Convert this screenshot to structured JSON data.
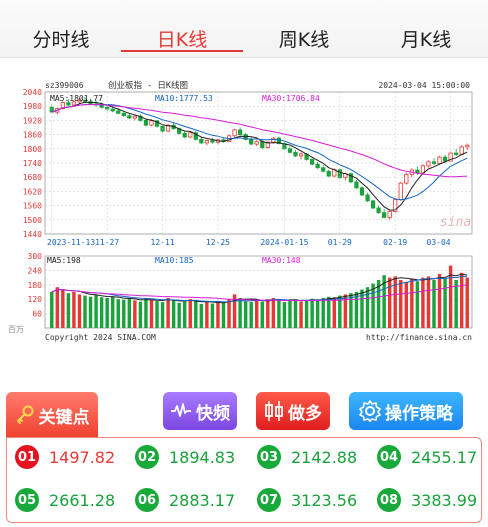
{
  "tabs": [
    {
      "label": "分时线",
      "active": false
    },
    {
      "label": "日K线",
      "active": true
    },
    {
      "label": "周K线",
      "active": false
    },
    {
      "label": "月K线",
      "active": false
    }
  ],
  "chart_header": {
    "symbol": "sz399006",
    "name": "创业板指 - 日K线图",
    "datetime": "2024-03-04 15:00:00",
    "ma5_label": "MA5:1801.77",
    "ma10_label": "MA10:1777.53",
    "ma30_label": "MA30:1706.84"
  },
  "volume_header": {
    "ma5_label": "MA5:198",
    "ma10_label": "MA10:185",
    "ma30_label": "MA30:148",
    "unit": "百万"
  },
  "footer": {
    "copyright": "Copyright 2024 SINA.COM",
    "url": "http://finance.sina.cn",
    "watermark": "sina"
  },
  "colors": {
    "up": "#e53935",
    "down": "#1aa23c",
    "ma5": "#222222",
    "ma10": "#1565c0",
    "ma30": "#d81bd8"
  },
  "chart_data": {
    "type": "candlestick",
    "title": "创业板指 - 日K线图",
    "price_axis": {
      "ylim": [
        1440,
        2040
      ],
      "ticks": [
        2040,
        1980,
        1920,
        1860,
        1800,
        1740,
        1680,
        1620,
        1560,
        1500,
        1440
      ]
    },
    "x_ticks": [
      "2023-11-13",
      "11-27",
      "12-11",
      "12-25",
      "2024-01-15",
      "01-29",
      "02-19",
      "03-04"
    ],
    "volume_axis": {
      "ylim": [
        0,
        300
      ],
      "ticks": [
        300,
        240,
        180,
        120,
        60
      ]
    },
    "candles": [
      {
        "o": 1975,
        "h": 1990,
        "l": 1950,
        "c": 1955
      },
      {
        "o": 1955,
        "h": 1975,
        "l": 1945,
        "c": 1970
      },
      {
        "o": 1970,
        "h": 2000,
        "l": 1965,
        "c": 1995
      },
      {
        "o": 1995,
        "h": 2010,
        "l": 1980,
        "c": 1985
      },
      {
        "o": 1985,
        "h": 2005,
        "l": 1975,
        "c": 1998
      },
      {
        "o": 1998,
        "h": 2015,
        "l": 1990,
        "c": 2005
      },
      {
        "o": 2005,
        "h": 2020,
        "l": 1995,
        "c": 2000
      },
      {
        "o": 2000,
        "h": 2012,
        "l": 1985,
        "c": 1990
      },
      {
        "o": 1990,
        "h": 2005,
        "l": 1978,
        "c": 1985
      },
      {
        "o": 1985,
        "h": 1995,
        "l": 1970,
        "c": 1975
      },
      {
        "o": 1975,
        "h": 1988,
        "l": 1960,
        "c": 1968
      },
      {
        "o": 1968,
        "h": 1980,
        "l": 1955,
        "c": 1960
      },
      {
        "o": 1960,
        "h": 1972,
        "l": 1945,
        "c": 1950
      },
      {
        "o": 1950,
        "h": 1960,
        "l": 1935,
        "c": 1940
      },
      {
        "o": 1940,
        "h": 1950,
        "l": 1925,
        "c": 1930
      },
      {
        "o": 1930,
        "h": 1945,
        "l": 1920,
        "c": 1938
      },
      {
        "o": 1938,
        "h": 1946,
        "l": 1915,
        "c": 1920
      },
      {
        "o": 1920,
        "h": 1928,
        "l": 1895,
        "c": 1900
      },
      {
        "o": 1900,
        "h": 1925,
        "l": 1895,
        "c": 1918
      },
      {
        "o": 1918,
        "h": 1922,
        "l": 1890,
        "c": 1895
      },
      {
        "o": 1895,
        "h": 1900,
        "l": 1870,
        "c": 1875
      },
      {
        "o": 1875,
        "h": 1905,
        "l": 1870,
        "c": 1900
      },
      {
        "o": 1900,
        "h": 1910,
        "l": 1880,
        "c": 1885
      },
      {
        "o": 1885,
        "h": 1890,
        "l": 1860,
        "c": 1865
      },
      {
        "o": 1865,
        "h": 1878,
        "l": 1845,
        "c": 1850
      },
      {
        "o": 1850,
        "h": 1872,
        "l": 1845,
        "c": 1868
      },
      {
        "o": 1868,
        "h": 1875,
        "l": 1835,
        "c": 1840
      },
      {
        "o": 1840,
        "h": 1852,
        "l": 1820,
        "c": 1825
      },
      {
        "o": 1825,
        "h": 1840,
        "l": 1815,
        "c": 1835
      },
      {
        "o": 1835,
        "h": 1845,
        "l": 1822,
        "c": 1828
      },
      {
        "o": 1828,
        "h": 1842,
        "l": 1818,
        "c": 1838
      },
      {
        "o": 1838,
        "h": 1848,
        "l": 1825,
        "c": 1830
      },
      {
        "o": 1830,
        "h": 1860,
        "l": 1828,
        "c": 1855
      },
      {
        "o": 1855,
        "h": 1885,
        "l": 1850,
        "c": 1880
      },
      {
        "o": 1880,
        "h": 1890,
        "l": 1855,
        "c": 1860
      },
      {
        "o": 1860,
        "h": 1866,
        "l": 1835,
        "c": 1840
      },
      {
        "o": 1840,
        "h": 1848,
        "l": 1815,
        "c": 1820
      },
      {
        "o": 1820,
        "h": 1836,
        "l": 1812,
        "c": 1830
      },
      {
        "o": 1830,
        "h": 1838,
        "l": 1800,
        "c": 1805
      },
      {
        "o": 1805,
        "h": 1832,
        "l": 1800,
        "c": 1828
      },
      {
        "o": 1828,
        "h": 1850,
        "l": 1822,
        "c": 1845
      },
      {
        "o": 1845,
        "h": 1852,
        "l": 1818,
        "c": 1822
      },
      {
        "o": 1822,
        "h": 1828,
        "l": 1795,
        "c": 1800
      },
      {
        "o": 1800,
        "h": 1810,
        "l": 1780,
        "c": 1785
      },
      {
        "o": 1785,
        "h": 1795,
        "l": 1765,
        "c": 1770
      },
      {
        "o": 1770,
        "h": 1785,
        "l": 1755,
        "c": 1778
      },
      {
        "o": 1778,
        "h": 1782,
        "l": 1750,
        "c": 1755
      },
      {
        "o": 1755,
        "h": 1760,
        "l": 1730,
        "c": 1735
      },
      {
        "o": 1735,
        "h": 1745,
        "l": 1715,
        "c": 1720
      },
      {
        "o": 1720,
        "h": 1730,
        "l": 1700,
        "c": 1705
      },
      {
        "o": 1705,
        "h": 1712,
        "l": 1680,
        "c": 1685
      },
      {
        "o": 1685,
        "h": 1718,
        "l": 1680,
        "c": 1712
      },
      {
        "o": 1712,
        "h": 1718,
        "l": 1672,
        "c": 1678
      },
      {
        "o": 1678,
        "h": 1700,
        "l": 1665,
        "c": 1695
      },
      {
        "o": 1695,
        "h": 1700,
        "l": 1655,
        "c": 1660
      },
      {
        "o": 1660,
        "h": 1668,
        "l": 1630,
        "c": 1635
      },
      {
        "o": 1635,
        "h": 1642,
        "l": 1600,
        "c": 1605
      },
      {
        "o": 1605,
        "h": 1615,
        "l": 1575,
        "c": 1580
      },
      {
        "o": 1580,
        "h": 1585,
        "l": 1545,
        "c": 1550
      },
      {
        "o": 1550,
        "h": 1560,
        "l": 1525,
        "c": 1530
      },
      {
        "o": 1530,
        "h": 1545,
        "l": 1505,
        "c": 1510
      },
      {
        "o": 1510,
        "h": 1540,
        "l": 1500,
        "c": 1535
      },
      {
        "o": 1535,
        "h": 1590,
        "l": 1530,
        "c": 1585
      },
      {
        "o": 1585,
        "h": 1660,
        "l": 1580,
        "c": 1655
      },
      {
        "o": 1655,
        "h": 1700,
        "l": 1648,
        "c": 1692
      },
      {
        "o": 1692,
        "h": 1718,
        "l": 1680,
        "c": 1710
      },
      {
        "o": 1710,
        "h": 1725,
        "l": 1690,
        "c": 1698
      },
      {
        "o": 1698,
        "h": 1735,
        "l": 1695,
        "c": 1728
      },
      {
        "o": 1728,
        "h": 1752,
        "l": 1720,
        "c": 1745
      },
      {
        "o": 1745,
        "h": 1760,
        "l": 1730,
        "c": 1738
      },
      {
        "o": 1738,
        "h": 1770,
        "l": 1735,
        "c": 1765
      },
      {
        "o": 1765,
        "h": 1775,
        "l": 1740,
        "c": 1748
      },
      {
        "o": 1748,
        "h": 1788,
        "l": 1745,
        "c": 1782
      },
      {
        "o": 1782,
        "h": 1800,
        "l": 1770,
        "c": 1776
      },
      {
        "o": 1776,
        "h": 1815,
        "l": 1772,
        "c": 1808
      },
      {
        "o": 1808,
        "h": 1822,
        "l": 1795,
        "c": 1815
      }
    ],
    "volumes": [
      150,
      170,
      160,
      145,
      150,
      140,
      135,
      130,
      138,
      128,
      125,
      132,
      120,
      118,
      122,
      115,
      110,
      125,
      118,
      112,
      108,
      125,
      115,
      105,
      110,
      120,
      112,
      100,
      108,
      102,
      110,
      105,
      120,
      140,
      125,
      112,
      108,
      115,
      110,
      120,
      125,
      115,
      108,
      118,
      120,
      110,
      115,
      122,
      118,
      125,
      130,
      128,
      135,
      140,
      145,
      150,
      160,
      170,
      185,
      200,
      220,
      210,
      215,
      200,
      190,
      205,
      195,
      210,
      215,
      200,
      225,
      205,
      260,
      200,
      230,
      210
    ]
  },
  "key_points": {
    "header_label": "关键点",
    "items": [
      {
        "id": "01",
        "value": "1497.82",
        "tone": "red"
      },
      {
        "id": "02",
        "value": "1894.83",
        "tone": "green"
      },
      {
        "id": "03",
        "value": "2142.88",
        "tone": "green"
      },
      {
        "id": "04",
        "value": "2455.17",
        "tone": "green"
      },
      {
        "id": "05",
        "value": "2661.28",
        "tone": "green"
      },
      {
        "id": "06",
        "value": "2883.17",
        "tone": "green"
      },
      {
        "id": "07",
        "value": "3123.56",
        "tone": "green"
      },
      {
        "id": "08",
        "value": "3383.99",
        "tone": "green"
      }
    ]
  },
  "toolbar": {
    "fast_label": "快频",
    "more_label": "做多",
    "strategy_label": "操作策略"
  }
}
